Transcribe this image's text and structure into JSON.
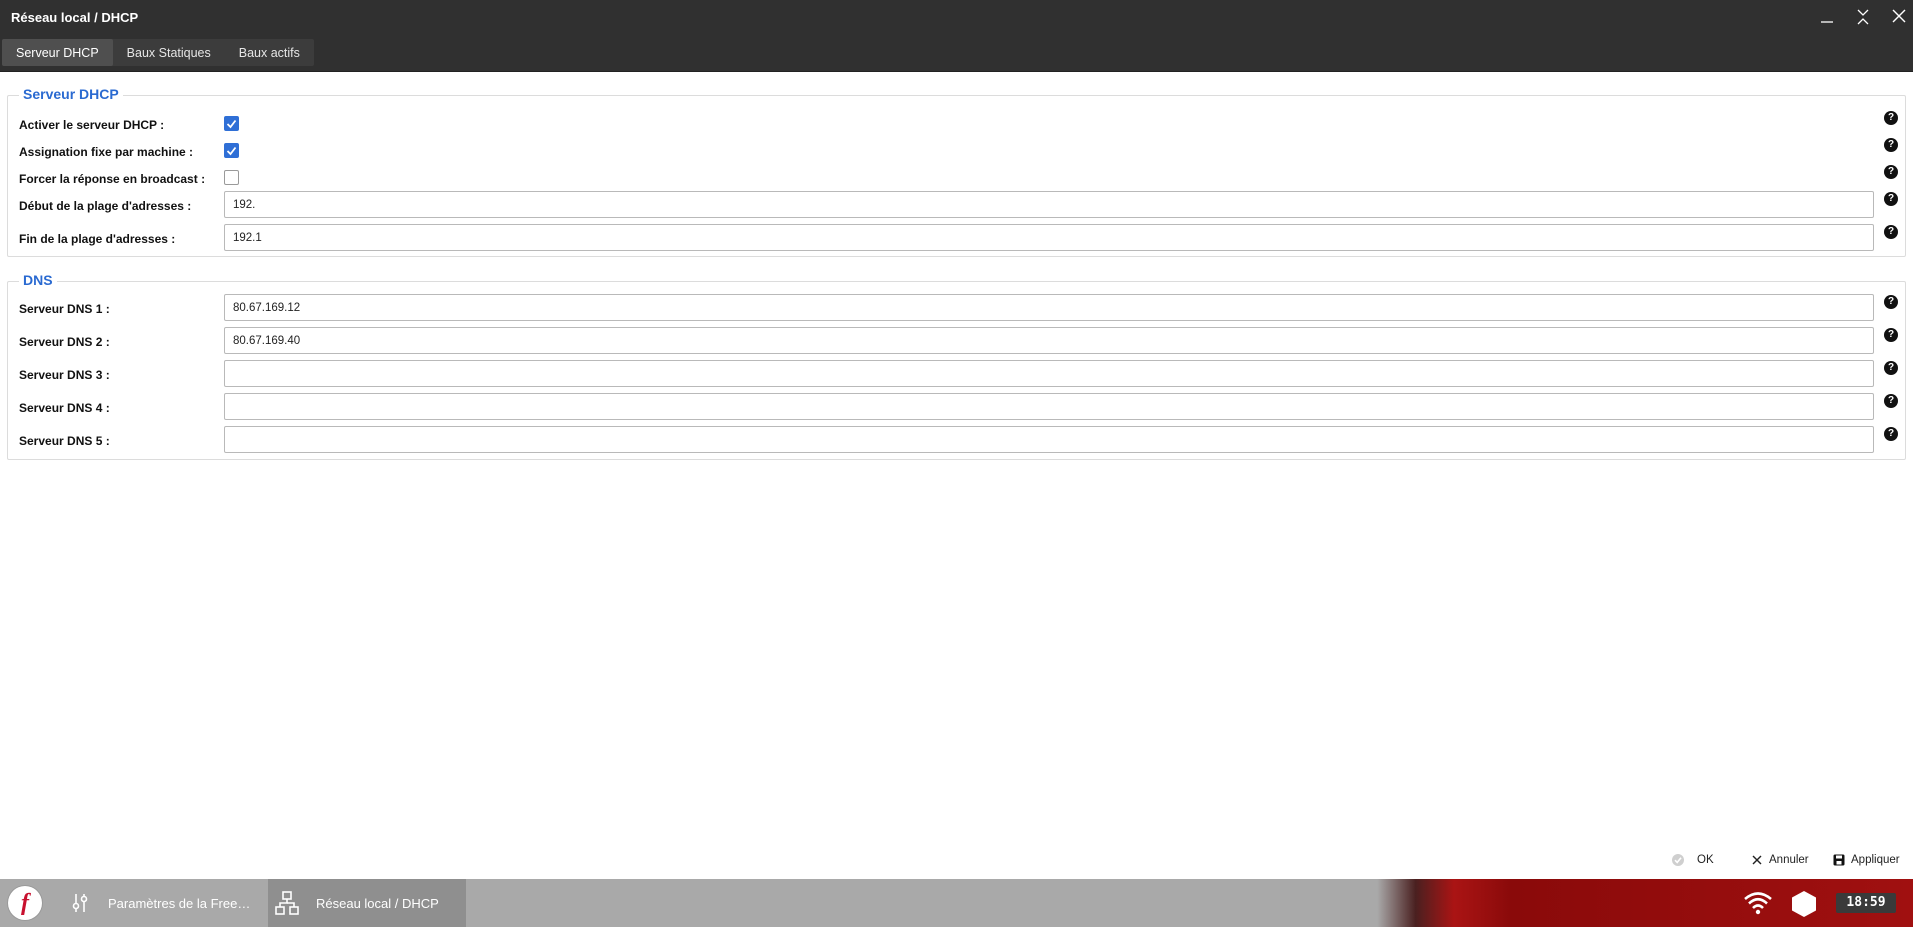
{
  "window": {
    "title": "Réseau local / DHCP"
  },
  "tabs": [
    {
      "label": "Serveur DHCP",
      "active": true
    },
    {
      "label": "Baux Statiques",
      "active": false
    },
    {
      "label": "Baux actifs",
      "active": false
    }
  ],
  "dhcp": {
    "legend": "Serveur DHCP",
    "enable_label": "Activer le serveur DHCP :",
    "enable_checked": true,
    "fixed_label": "Assignation fixe par machine :",
    "fixed_checked": true,
    "broadcast_label": "Forcer la réponse en broadcast :",
    "broadcast_checked": false,
    "start_label": "Début de la plage d'adresses :",
    "start_value": "192.",
    "end_label": "Fin de la plage d'adresses :",
    "end_value": "192.1"
  },
  "dns": {
    "legend": "DNS",
    "servers": [
      {
        "label": "Serveur DNS 1 :",
        "value": "80.67.169.12"
      },
      {
        "label": "Serveur DNS 2 :",
        "value": "80.67.169.40"
      },
      {
        "label": "Serveur DNS 3 :",
        "value": ""
      },
      {
        "label": "Serveur DNS 4 :",
        "value": ""
      },
      {
        "label": "Serveur DNS 5 :",
        "value": ""
      }
    ]
  },
  "help_glyph": "?",
  "footer": {
    "ok_label": "OK",
    "cancel_label": "Annuler",
    "apply_label": "Appliquer"
  },
  "taskbar": {
    "start_glyph": "f",
    "tasks": [
      {
        "label": "Paramètres de la Free…",
        "icon": "sliders-icon"
      },
      {
        "label": "Réseau local / DHCP",
        "icon": "network-icon"
      }
    ],
    "clock": "18:59"
  },
  "colors": {
    "accent": "#2a6ad1",
    "titlebar": "#303030",
    "checkbox": "#2f6fd6",
    "taskbar_red": "#a01010"
  }
}
